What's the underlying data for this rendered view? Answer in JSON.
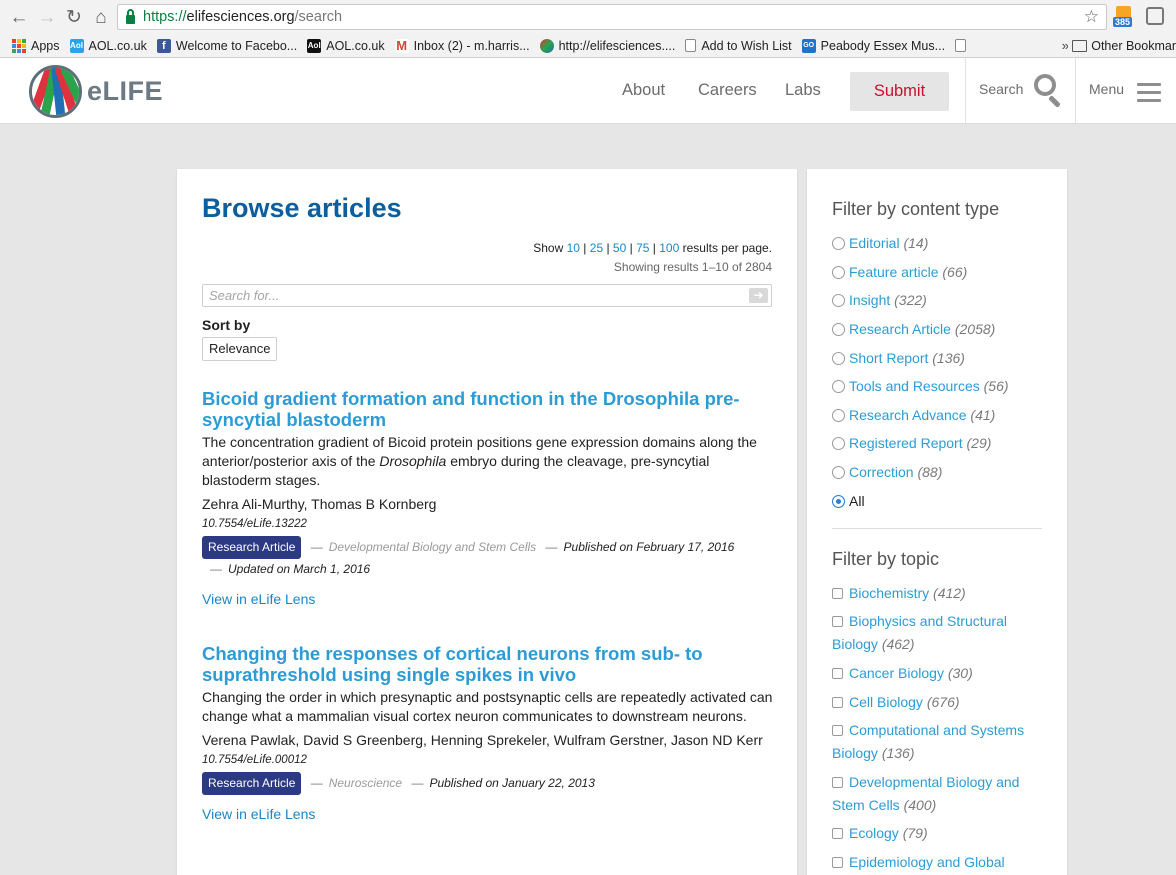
{
  "browser": {
    "url_secure": "https://",
    "url_host": "elifesciences.org",
    "url_path": "/search",
    "rss_badge": "385",
    "bookmarks": [
      {
        "label": "Apps",
        "icon": "apps-grid-icon"
      },
      {
        "label": "AOL.co.uk",
        "icon": "aol-icon"
      },
      {
        "label": "Welcome to Facebo...",
        "icon": "facebook-icon"
      },
      {
        "label": "AOL.co.uk",
        "icon": "aol-icon"
      },
      {
        "label": "Inbox (2) - m.harris...",
        "icon": "gmail-icon"
      },
      {
        "label": "http://elifesciences....",
        "icon": "elife-icon"
      },
      {
        "label": "Add to Wish List",
        "icon": "document-icon"
      },
      {
        "label": "Peabody Essex Mus...",
        "icon": "go-icon"
      }
    ],
    "other_bookmarks": "Other Bookmar"
  },
  "header": {
    "logo_text": "eLIFE",
    "nav": [
      "About",
      "Careers",
      "Labs"
    ],
    "submit": "Submit",
    "search": "Search",
    "menu": "Menu",
    "accent": "#c8102e"
  },
  "main": {
    "title": "Browse articles",
    "show_prefix": "Show",
    "page_sizes": [
      "10",
      "25",
      "50",
      "75",
      "100"
    ],
    "show_suffix": "results per page.",
    "results_count": "Showing results 1–10 of 2804",
    "search_placeholder": "Search for...",
    "sort_label": "Sort by",
    "sort_value": "Relevance",
    "articles": [
      {
        "title": "Bicoid gradient formation and function in the Drosophila pre-syncytial blastoderm",
        "abstract_before": "The concentration gradient of Bicoid protein positions gene expression domains along the anterior/posterior axis of the ",
        "abstract_italic": "Drosophila",
        "abstract_after": " embryo during the cleavage, pre-syncytial blastoderm stages.",
        "authors": "Zehra Ali-Murthy, Thomas B Kornberg",
        "doi": "10.7554/eLife.13222",
        "type": "Research Article",
        "subject": "Developmental Biology and Stem Cells",
        "published": "Published on February 17, 2016",
        "updated": "Updated on March 1, 2016",
        "lens": "View in eLife Lens"
      },
      {
        "title": "Changing the responses of cortical neurons from sub- to suprathreshold using single spikes in vivo",
        "abstract_before": "Changing the order in which presynaptic and postsynaptic cells are repeatedly activated can change what a mammalian visual cortex neuron communicates to downstream neurons.",
        "abstract_italic": "",
        "abstract_after": "",
        "authors": "Verena Pawlak, David S Greenberg, Henning Sprekeler, Wulfram Gerstner, Jason ND Kerr",
        "doi": "10.7554/eLife.00012",
        "type": "Research Article",
        "subject": "Neuroscience",
        "published": "Published on January 22, 2013",
        "updated": "",
        "lens": "View in eLife Lens"
      }
    ]
  },
  "sidebar": {
    "content_type_heading": "Filter by content type",
    "content_types": [
      {
        "label": "Editorial",
        "count": "(14)",
        "selected": false
      },
      {
        "label": "Feature article",
        "count": "(66)",
        "selected": false
      },
      {
        "label": "Insight",
        "count": "(322)",
        "selected": false
      },
      {
        "label": "Research Article",
        "count": "(2058)",
        "selected": false
      },
      {
        "label": "Short Report",
        "count": "(136)",
        "selected": false
      },
      {
        "label": "Tools and Resources",
        "count": "(56)",
        "selected": false
      },
      {
        "label": "Research Advance",
        "count": "(41)",
        "selected": false
      },
      {
        "label": "Registered Report",
        "count": "(29)",
        "selected": false
      },
      {
        "label": "Correction",
        "count": "(88)",
        "selected": false
      },
      {
        "label": "All",
        "count": "",
        "selected": true
      }
    ],
    "topic_heading": "Filter by topic",
    "topics": [
      {
        "label": "Biochemistry",
        "count": "(412)"
      },
      {
        "label": "Biophysics and Structural Biology",
        "count": "(462)"
      },
      {
        "label": "Cancer Biology",
        "count": "(30)"
      },
      {
        "label": "Cell Biology",
        "count": "(676)"
      },
      {
        "label": "Computational and Systems Biology",
        "count": "(136)"
      },
      {
        "label": "Developmental Biology and Stem Cells",
        "count": "(400)"
      },
      {
        "label": "Ecology",
        "count": "(79)"
      },
      {
        "label": "Epidemiology and Global",
        "count": ""
      }
    ]
  }
}
